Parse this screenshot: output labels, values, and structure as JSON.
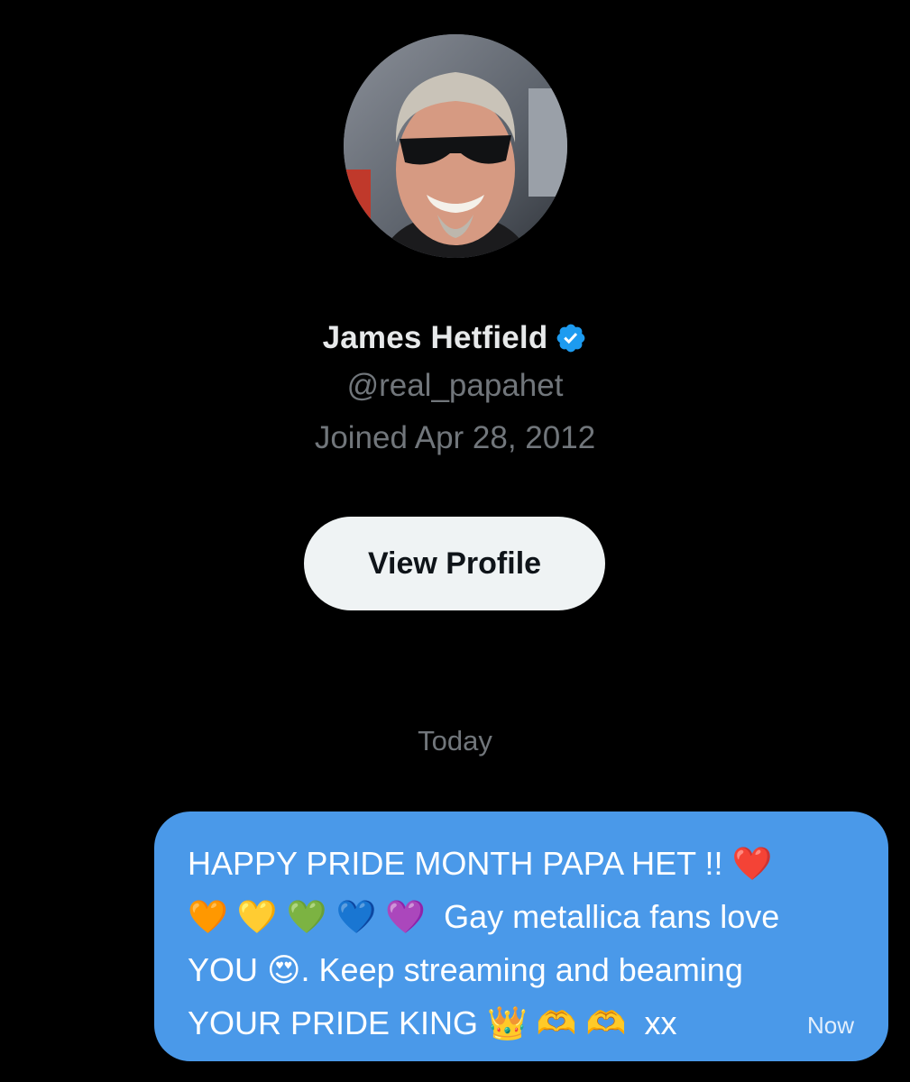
{
  "profile": {
    "display_name": "James Hetfield",
    "verified": true,
    "handle": "@real_papahet",
    "joined": "Joined Apr 28, 2012",
    "avatar_icon": "profile-photo-avatar"
  },
  "actions": {
    "view_profile_label": "View Profile"
  },
  "conversation": {
    "date_separator": "Today",
    "messages": [
      {
        "direction": "outgoing",
        "text": "HAPPY PRIDE MONTH PAPA HET !! ❤️\n🧡 💛 💚 💙 💜  Gay metallica fans love\nYOU 😍. Keep streaming and beaming\nYOUR PRIDE KING 👑 🫶 🫶  xx",
        "time": "Now"
      }
    ]
  },
  "colors": {
    "background": "#000000",
    "primary_text": "#e7e9ea",
    "secondary_text": "#71767b",
    "button_bg": "#eff3f4",
    "button_text": "#0f1419",
    "bubble_bg": "#4a99e9",
    "verified_badge": "#1d9bf0"
  }
}
